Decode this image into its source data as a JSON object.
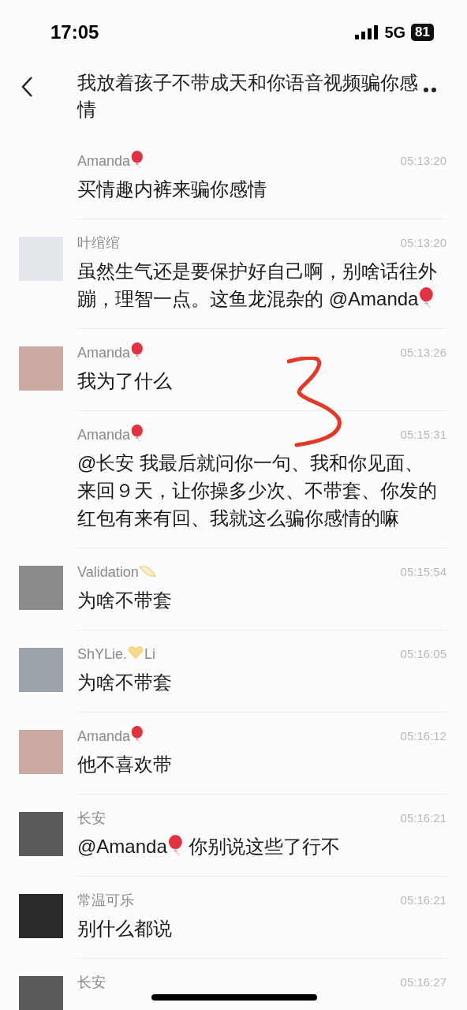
{
  "status_bar": {
    "time": "17:05",
    "network": "5G",
    "battery": "81"
  },
  "header": {
    "title": "我放着孩子不带成天和你语音视频骗你感情"
  },
  "messages": [
    {
      "name": [
        {
          "kind": "text",
          "text": "Amanda"
        },
        {
          "kind": "balloon"
        }
      ],
      "time": "05:13:20",
      "text": [
        {
          "kind": "text",
          "text": "买情趣内裤来骗你感情"
        }
      ]
    },
    {
      "color": "#e3e6ea",
      "name": [
        {
          "kind": "text",
          "text": "叶绾绾"
        }
      ],
      "time": "05:13:20",
      "text": [
        {
          "kind": "text",
          "text": "虽然生气还是要保护好自己啊，别啥话往外蹦，理智一点。这鱼龙混杂的 @Amanda"
        },
        {
          "kind": "balloon"
        }
      ]
    },
    {
      "color": "#c9a9a0",
      "name": [
        {
          "kind": "text",
          "text": "Amanda"
        },
        {
          "kind": "balloon"
        }
      ],
      "time": "05:13:26",
      "text": [
        {
          "kind": "text",
          "text": "我为了什么"
        }
      ]
    },
    {
      "name": [
        {
          "kind": "text",
          "text": "Amanda"
        },
        {
          "kind": "balloon"
        }
      ],
      "time": "05:15:31",
      "text": [
        {
          "kind": "text",
          "text": "@长安 我最后就问你一句、我和你见面、来回９天，让你操多少次、不带套、你发的红包有来有回、我就这么骗你感情的嘛"
        }
      ]
    },
    {
      "color": "#8a8a8a",
      "name": [
        {
          "kind": "text",
          "text": "Validation"
        },
        {
          "kind": "feather"
        }
      ],
      "time": "05:15:54",
      "text": [
        {
          "kind": "text",
          "text": "为啥不带套"
        }
      ]
    },
    {
      "color": "#9aa3aa",
      "name": [
        {
          "kind": "text",
          "text": "ShYLie."
        },
        {
          "kind": "heart"
        },
        {
          "kind": "text",
          "text": "Li"
        }
      ],
      "time": "05:16:05",
      "text": [
        {
          "kind": "text",
          "text": "为啥不带套"
        }
      ]
    },
    {
      "color": "#c9a9a0",
      "name": [
        {
          "kind": "text",
          "text": "Amanda"
        },
        {
          "kind": "balloon"
        }
      ],
      "time": "05:16:12",
      "text": [
        {
          "kind": "text",
          "text": "他不喜欢带"
        }
      ]
    },
    {
      "color": "#5a5a5a",
      "name": [
        {
          "kind": "text",
          "text": "长安"
        }
      ],
      "time": "05:16:21",
      "text": [
        {
          "kind": "text",
          "text": "@Amanda"
        },
        {
          "kind": "balloon"
        },
        {
          "kind": "text",
          "text": " 你别说这些了行不"
        }
      ]
    },
    {
      "color": "#2a2a2a",
      "name": [
        {
          "kind": "text",
          "text": "常温可乐"
        }
      ],
      "time": "05:16:21",
      "text": [
        {
          "kind": "text",
          "text": "别什么都说"
        }
      ]
    },
    {
      "color": "#5a5a5a",
      "name": [
        {
          "kind": "text",
          "text": "长安"
        }
      ],
      "time": "05:16:27"
    }
  ]
}
